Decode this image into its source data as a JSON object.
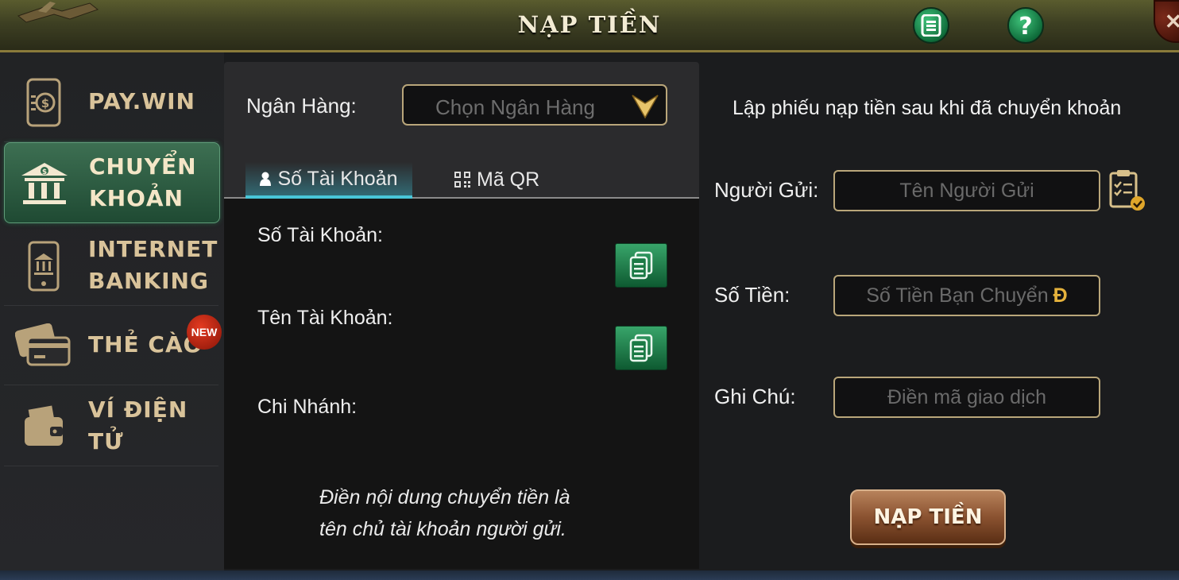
{
  "header": {
    "title": "NẠP TIỀN",
    "icons": [
      "list-icon",
      "help-icon",
      "close-icon"
    ]
  },
  "sidebar": {
    "items": [
      {
        "label_1": "PAY.WIN",
        "label_2": "",
        "icon": "pay-icon"
      },
      {
        "label_1": "CHUYỂN",
        "label_2": "KHOẢN",
        "icon": "bank-icon",
        "active": true
      },
      {
        "label_1": "INTERNET",
        "label_2": "BANKING",
        "icon": "phone-bank-icon"
      },
      {
        "label_1": "THẺ CÀO",
        "label_2": "",
        "icon": "card-icon",
        "badge": "NEW"
      },
      {
        "label_1": "VÍ ĐIỆN TỬ",
        "label_2": "",
        "icon": "wallet-icon"
      }
    ]
  },
  "center": {
    "bank_label": "Ngân Hàng:",
    "bank_placeholder": "Chọn Ngân Hàng",
    "tabs": [
      {
        "label": "Số Tài Khoản",
        "active": true
      },
      {
        "label": "Mã QR",
        "active": false
      }
    ],
    "fields": {
      "account_number": "Số Tài Khoản:",
      "account_name": "Tên Tài Khoản:",
      "branch": "Chi Nhánh:"
    },
    "note_line_1": "Điền nội dung chuyển tiền là",
    "note_line_2": "tên chủ tài khoản người gửi."
  },
  "right": {
    "title": "Lập phiếu nạp tiền sau khi đã chuyển khoản",
    "sender_label": "Người Gửi:",
    "sender_placeholder": "Tên Người Gửi",
    "amount_label": "Số Tiền:",
    "amount_placeholder": "Số Tiền Bạn Chuyển",
    "currency_symbol": "Đ",
    "note_label": "Ghi Chú:",
    "note_placeholder": "Điền mã giao dịch",
    "submit_label": "NẠP TIỀN"
  },
  "colors": {
    "accent_gold": "#b9a67a",
    "active_green": "#2f6a4a",
    "tab_cyan": "#49c6d8",
    "submit_brown": "#8a5230"
  }
}
